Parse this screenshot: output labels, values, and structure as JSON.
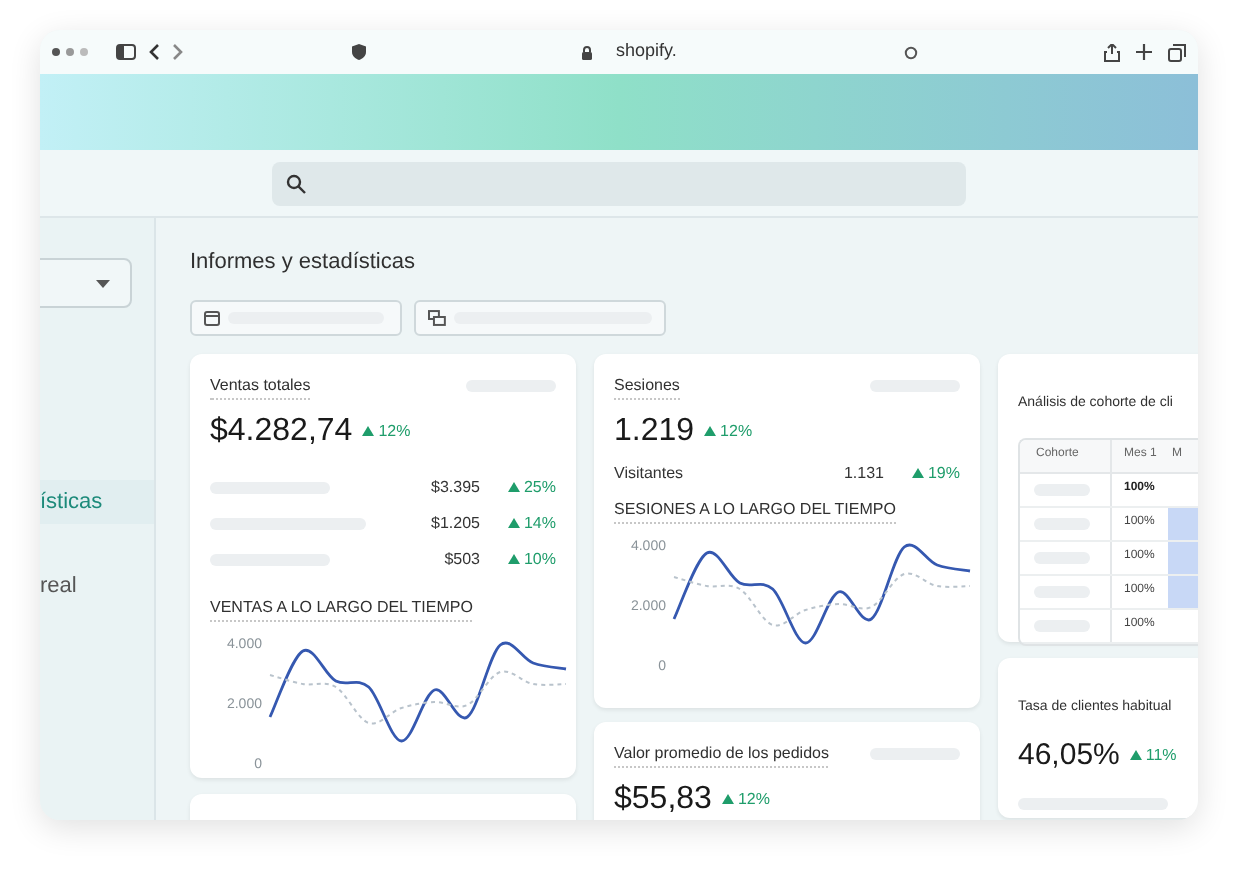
{
  "browser": {
    "address": "shopify."
  },
  "sidebar": {
    "items": [
      {
        "label": "ísticas",
        "selected": true
      },
      {
        "label": "real",
        "selected": false
      }
    ]
  },
  "page": {
    "title": "Informes y estadísticas"
  },
  "sales": {
    "title": "Ventas totales",
    "value": "$4.282,74",
    "change": "12%",
    "rows": [
      {
        "amount": "$3.395",
        "change": "25%"
      },
      {
        "amount": "$1.205",
        "change": "14%"
      },
      {
        "amount": "$503",
        "change": "10%"
      }
    ],
    "chart_title": "VENTAS A LO LARGO DEL TIEMPO",
    "chart_data": {
      "type": "line",
      "ylim": [
        0,
        4000
      ],
      "yticks": [
        {
          "value": 4000,
          "label": "4.000"
        },
        {
          "value": 2000,
          "label": "2.000"
        },
        {
          "value": 0,
          "label": "0"
        }
      ],
      "series": [
        {
          "color": "#3558b0",
          "line_style": "solid",
          "values": [
            1500,
            3700,
            2700,
            2500,
            700,
            2400,
            1500,
            3900,
            3300,
            3100
          ]
        },
        {
          "color": "#b9c3cc",
          "line_style": "dashed",
          "values": [
            2900,
            2600,
            2500,
            1300,
            1800,
            2000,
            1900,
            3000,
            2600,
            2600
          ]
        }
      ]
    }
  },
  "sessions": {
    "title": "Sesiones",
    "value": "1.219",
    "change": "12%",
    "visitors_label": "Visitantes",
    "visitors_value": "1.131",
    "visitors_change": "19%",
    "chart_title": "SESIONES A LO LARGO DEL TIEMPO",
    "chart_data": {
      "type": "line",
      "ylim": [
        0,
        4000
      ],
      "yticks": [
        {
          "value": 4000,
          "label": "4.000"
        },
        {
          "value": 2000,
          "label": "2.000"
        },
        {
          "value": 0,
          "label": "0"
        }
      ],
      "series": [
        {
          "color": "#3558b0",
          "line_style": "solid",
          "values": [
            1500,
            3700,
            2700,
            2500,
            700,
            2400,
            1500,
            3900,
            3300,
            3100
          ]
        },
        {
          "color": "#b9c3cc",
          "line_style": "dashed",
          "values": [
            2900,
            2600,
            2500,
            1300,
            1800,
            2000,
            1900,
            3000,
            2600,
            2600
          ]
        }
      ]
    }
  },
  "average_order": {
    "title": "Valor promedio de los pedidos",
    "value": "$55,83",
    "change": "12%"
  },
  "cohort": {
    "title": "Análisis de cohorte de cli",
    "columns": [
      "Cohorte",
      "Mes 1",
      "M"
    ],
    "rows": [
      {
        "month_1": "100%",
        "bold": true,
        "highlighted": false
      },
      {
        "month_1": "100%",
        "bold": false,
        "highlighted": true
      },
      {
        "month_1": "100%",
        "bold": false,
        "highlighted": true
      },
      {
        "month_1": "100%",
        "bold": false,
        "highlighted": true
      },
      {
        "month_1": "100%",
        "bold": false,
        "highlighted": false
      }
    ]
  },
  "returning": {
    "title": "Tasa de clientes habitual",
    "value": "46,05%",
    "change": "11%"
  }
}
